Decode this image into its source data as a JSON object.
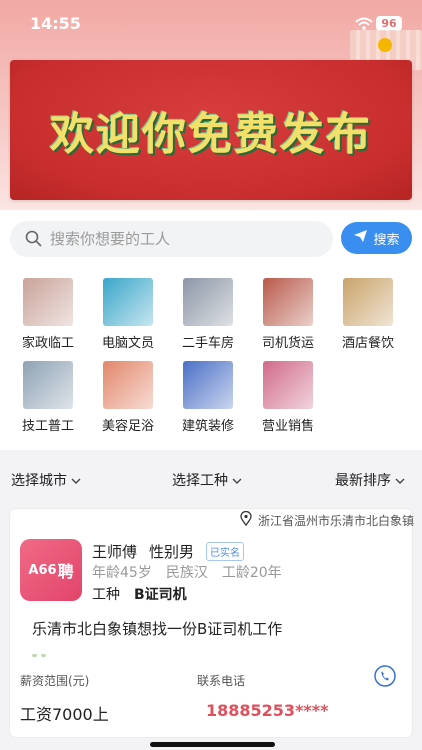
{
  "status_bar": {
    "time": "14:55",
    "battery": "96"
  },
  "banner": {
    "text": "欢迎你免费发布"
  },
  "search": {
    "placeholder": "搜索你想要的工人",
    "button_label": "搜索"
  },
  "categories": [
    {
      "label": "家政临工",
      "icon": "housekeeping-icon",
      "color": "#c9a39a"
    },
    {
      "label": "电脑文员",
      "icon": "computer-icon",
      "color": "#3aa6c9"
    },
    {
      "label": "二手车房",
      "icon": "used-car-house-icon",
      "color": "#8c96a6"
    },
    {
      "label": "司机货运",
      "icon": "truck-icon",
      "color": "#b85a4a"
    },
    {
      "label": "酒店餐饮",
      "icon": "hotel-icon",
      "color": "#c9a36a"
    },
    {
      "label": "技工普工",
      "icon": "factory-icon",
      "color": "#8ea2b4"
    },
    {
      "label": "美容足浴",
      "icon": "foot-bath-icon",
      "color": "#e2876a"
    },
    {
      "label": "建筑装修",
      "icon": "building-icon",
      "color": "#4a6fc6"
    },
    {
      "label": "营业销售",
      "icon": "sales-icon",
      "color": "#d06a8a"
    }
  ],
  "filters": {
    "city": "选择城市",
    "work_type": "选择工种",
    "sort": "最新排序"
  },
  "card": {
    "location": "浙江省温州市乐清市北白象镇",
    "logo_text": "A66",
    "logo_sub": "聘",
    "name": "王师傅",
    "gender": "性别男",
    "verified": "已实名",
    "age": "年龄45岁",
    "ethnicity": "民族汉",
    "experience": "工龄20年",
    "type_label": "工种",
    "type_value": "B证司机",
    "description": "乐清市北白象镇想找一份B证司机工作",
    "salary_label": "薪资范围(元)",
    "phone_label": "联系电话",
    "salary": "工资7000上",
    "phone": "18885253****"
  }
}
